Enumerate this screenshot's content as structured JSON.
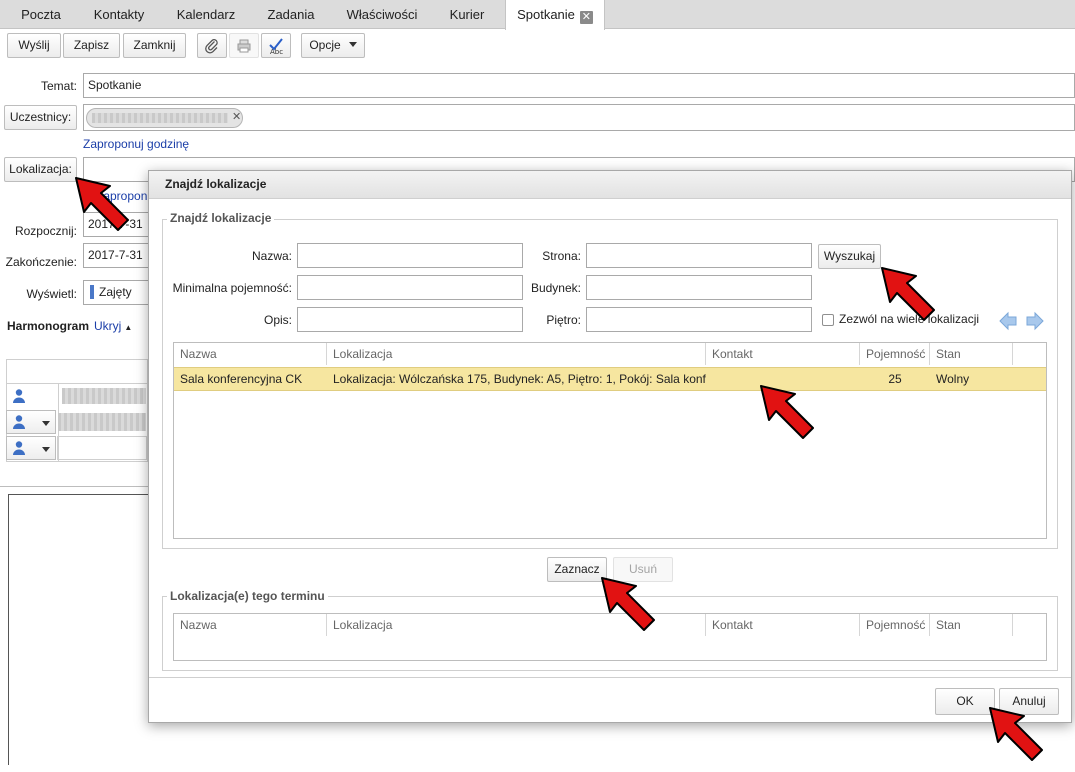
{
  "tabs": [
    {
      "label": "Poczta"
    },
    {
      "label": "Kontakty"
    },
    {
      "label": "Kalendarz"
    },
    {
      "label": "Zadania"
    },
    {
      "label": "Właściwości"
    },
    {
      "label": "Kurier"
    },
    {
      "label": "Spotkanie",
      "active": true
    }
  ],
  "toolbar": {
    "send": "Wyślij",
    "save": "Zapisz",
    "close": "Zamknij",
    "options": "Opcje"
  },
  "form": {
    "subject_label": "Temat:",
    "subject_value": "Spotkanie",
    "attendees_button": "Uczestnicy:",
    "suggest_time_link": "Zaproponuj godzinę",
    "location_button": "Lokalizacja:",
    "suggest_location_link": "Zaproponuj",
    "start_label": "Rozpocznij:",
    "start_value": "2017-7-31",
    "end_label": "Zakończenie:",
    "end_value": "2017-7-31",
    "show_label": "Wyświetl:",
    "show_value": "Zajęty",
    "schedule_label": "Harmonogram",
    "hide_link": "Ukryj"
  },
  "dialog": {
    "title": "Znajdź lokalizacje",
    "search_section": "Znajdź lokalizacje",
    "name_label": "Nazwa:",
    "site_label": "Strona:",
    "capacity_label": "Minimalna pojemność:",
    "building_label": "Budynek:",
    "desc_label": "Opis:",
    "floor_label": "Piętro:",
    "search_button": "Wyszukaj",
    "allow_multiple_label": "Zezwól na wiele lokalizacji",
    "columns": [
      "Nazwa",
      "Lokalizacja",
      "Kontakt",
      "Pojemność",
      "Stan"
    ],
    "results": [
      {
        "name": "Sala konferencyjna CK",
        "location": "Lokalizacja: Wólczańska 175, Budynek: A5, Piętro: 1, Pokój: Sala konfere",
        "contact": "",
        "capacity": "25",
        "status": "Wolny"
      }
    ],
    "select_button": "Zaznacz",
    "remove_button": "Usuń",
    "term_section": "Lokalizacja(e) tego terminu",
    "ok_button": "OK",
    "cancel_button": "Anuluj"
  },
  "colors": {
    "selected_row": "#f6e6a0",
    "link": "#1b3ea8",
    "arrow": "#e11212"
  }
}
